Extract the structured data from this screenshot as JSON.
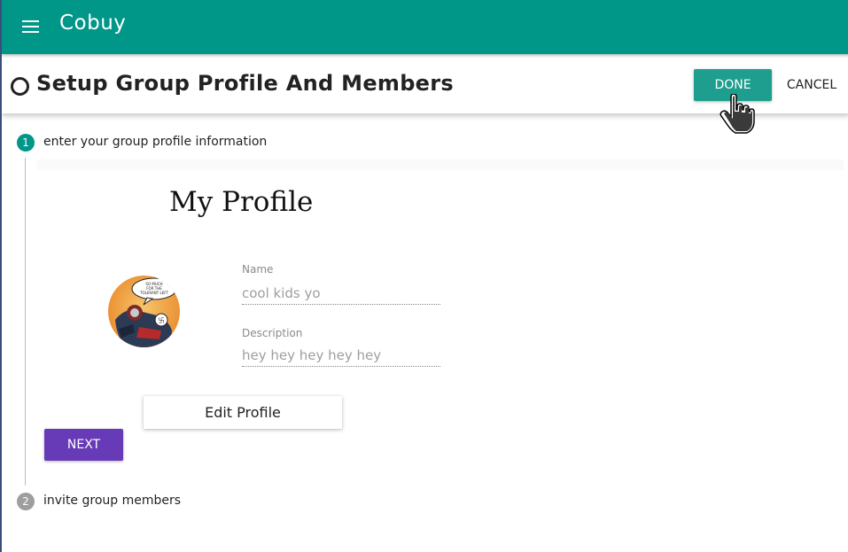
{
  "appbar": {
    "title": "Cobuy",
    "menu_icon": "hamburger-menu-icon"
  },
  "dialog": {
    "title": "Setup Group Profile And Members",
    "done_label": "DONE",
    "cancel_label": "CANCEL"
  },
  "stepper": {
    "steps": [
      {
        "number": "1",
        "label": "enter your group profile information",
        "active": true
      },
      {
        "number": "2",
        "label": "invite group members",
        "active": false
      }
    ]
  },
  "profile": {
    "heading": "My Profile",
    "name_label": "Name",
    "name_value": "cool kids yo",
    "description_label": "Description",
    "description_value": "hey hey hey hey hey",
    "edit_button": "Edit Profile",
    "avatar_speech_text": "SO MUCH FOR THE TOLERANT LEFT"
  },
  "actions": {
    "next_label": "NEXT"
  },
  "colors": {
    "appbar": "#009688",
    "done": "#1e9e8e",
    "next": "#673ab7",
    "step_active": "#009688",
    "step_inactive": "#9e9e9e"
  }
}
